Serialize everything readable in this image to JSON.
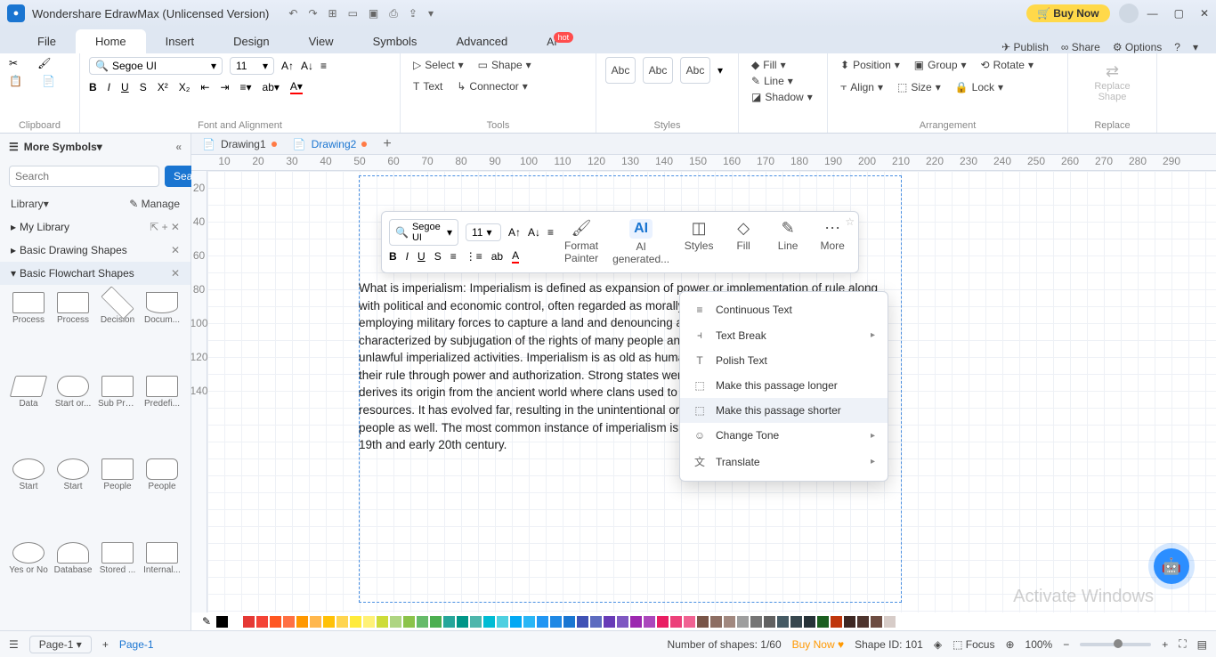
{
  "app": {
    "title": "Wondershare EdrawMax (Unlicensed Version)"
  },
  "buy": {
    "label": "Buy Now"
  },
  "menu": {
    "file": "File",
    "home": "Home",
    "insert": "Insert",
    "design": "Design",
    "view": "View",
    "symbols": "Symbols",
    "advanced": "Advanced",
    "ai": "AI",
    "hot": "hot",
    "publish": "Publish",
    "share": "Share",
    "options": "Options"
  },
  "ribbon": {
    "clipboard": "Clipboard",
    "fontalign": "Font and Alignment",
    "tools": "Tools",
    "styles": "Styles",
    "arrangement": "Arrangement",
    "replace": "Replace",
    "font": "Segoe UI",
    "size": "11",
    "select": "Select",
    "shape": "Shape",
    "text": "Text",
    "connector": "Connector",
    "fill": "Fill",
    "line": "Line",
    "shadow": "Shadow",
    "position": "Position",
    "align": "Align",
    "group": "Group",
    "sizebtn": "Size",
    "rotate": "Rotate",
    "lock": "Lock",
    "replacebtn": "Replace\nShape",
    "abc1": "Abc",
    "abc2": "Abc",
    "abc3": "Abc"
  },
  "sidebar": {
    "more": "More Symbols",
    "search_ph": "Search",
    "search_btn": "Search",
    "library": "Library",
    "manage": "Manage",
    "mylib": "My Library",
    "basicdraw": "Basic Drawing Shapes",
    "basicflow": "Basic Flowchart Shapes",
    "shapes": [
      {
        "l": "Process"
      },
      {
        "l": "Process"
      },
      {
        "l": "Decision"
      },
      {
        "l": "Docum..."
      },
      {
        "l": "Data"
      },
      {
        "l": "Start or..."
      },
      {
        "l": "Sub Pro..."
      },
      {
        "l": "Predefi..."
      },
      {
        "l": "Start"
      },
      {
        "l": "Start"
      },
      {
        "l": "People"
      },
      {
        "l": "People"
      },
      {
        "l": "Yes or No"
      },
      {
        "l": "Database"
      },
      {
        "l": "Stored ..."
      },
      {
        "l": "Internal..."
      }
    ]
  },
  "doctabs": {
    "d1": "Drawing1",
    "d2": "Drawing2"
  },
  "ruler_h": [
    "10",
    "20",
    "30",
    "40",
    "50",
    "60",
    "70",
    "80",
    "90",
    "100",
    "110",
    "120",
    "130",
    "140",
    "150",
    "160",
    "170",
    "180",
    "190",
    "200",
    "210",
    "220",
    "230",
    "240",
    "250",
    "260",
    "270",
    "280",
    "290"
  ],
  "ruler_v": [
    "20",
    "40",
    "60",
    "80",
    "100",
    "120",
    "140"
  ],
  "canvas": {
    "text": "What is imperialism: Imperialism is defined as expansion of power or implementation of rule along with political and economic control, often regarded as morally unacceptable. Imposition of rule by employing military forces to capture a land and denouncing a state's formal sovereignty is characterized by subjugation of the rights of many people and large-scale destruction through unlawful imperialized activities. Imperialism is as old as human civilization. Many empires expanded their rule through power and authorization. Strong states were unable to retaliate. Imperialism derives its origin from the ancient world where clans used to struggle for scarce food and resources. It has evolved far, resulting in the unintentional or deliberate loss of many innocent people as well. The most common instance of imperialism is the scramble by Europe during late 19th and early 20th century."
  },
  "float": {
    "font": "Segoe UI",
    "size": "11",
    "format": "Format\nPainter",
    "ai": "AI\ngenerated...",
    "styles": "Styles",
    "fill": "Fill",
    "line": "Line",
    "more": "More"
  },
  "ctx": {
    "cont": "Continuous Text",
    "break": "Text Break",
    "polish": "Polish Text",
    "longer": "Make this passage longer",
    "shorter": "Make this passage shorter",
    "tone": "Change Tone",
    "translate": "Translate"
  },
  "palette": [
    "#000",
    "#fff",
    "#e53935",
    "#f44336",
    "#ff5722",
    "#ff7043",
    "#ff9800",
    "#ffb74d",
    "#ffc107",
    "#ffd54f",
    "#ffeb3b",
    "#fff176",
    "#cddc39",
    "#aed581",
    "#8bc34a",
    "#66bb6a",
    "#4caf50",
    "#26a69a",
    "#009688",
    "#4db6ac",
    "#00bcd4",
    "#4dd0e1",
    "#03a9f4",
    "#29b6f6",
    "#2196f3",
    "#1e88e5",
    "#1976d2",
    "#3f51b5",
    "#5c6bc0",
    "#673ab7",
    "#7e57c2",
    "#9c27b0",
    "#ab47bc",
    "#e91e63",
    "#ec407a",
    "#f06292",
    "#795548",
    "#8d6e63",
    "#a1887f",
    "#9e9e9e",
    "#757575",
    "#616161",
    "#455a64",
    "#37474f",
    "#263238",
    "#1b5e20",
    "#bf360c",
    "#3e2723",
    "#4e342e",
    "#6d4c41",
    "#d7ccc8"
  ],
  "status": {
    "page": "Page-1",
    "page2": "Page-1",
    "shapes": "Number of shapes: 1/60",
    "buy": "Buy Now",
    "shapeid": "Shape ID: 101",
    "focus": "Focus",
    "zoom": "100%"
  },
  "watermark": "Activate Windows"
}
